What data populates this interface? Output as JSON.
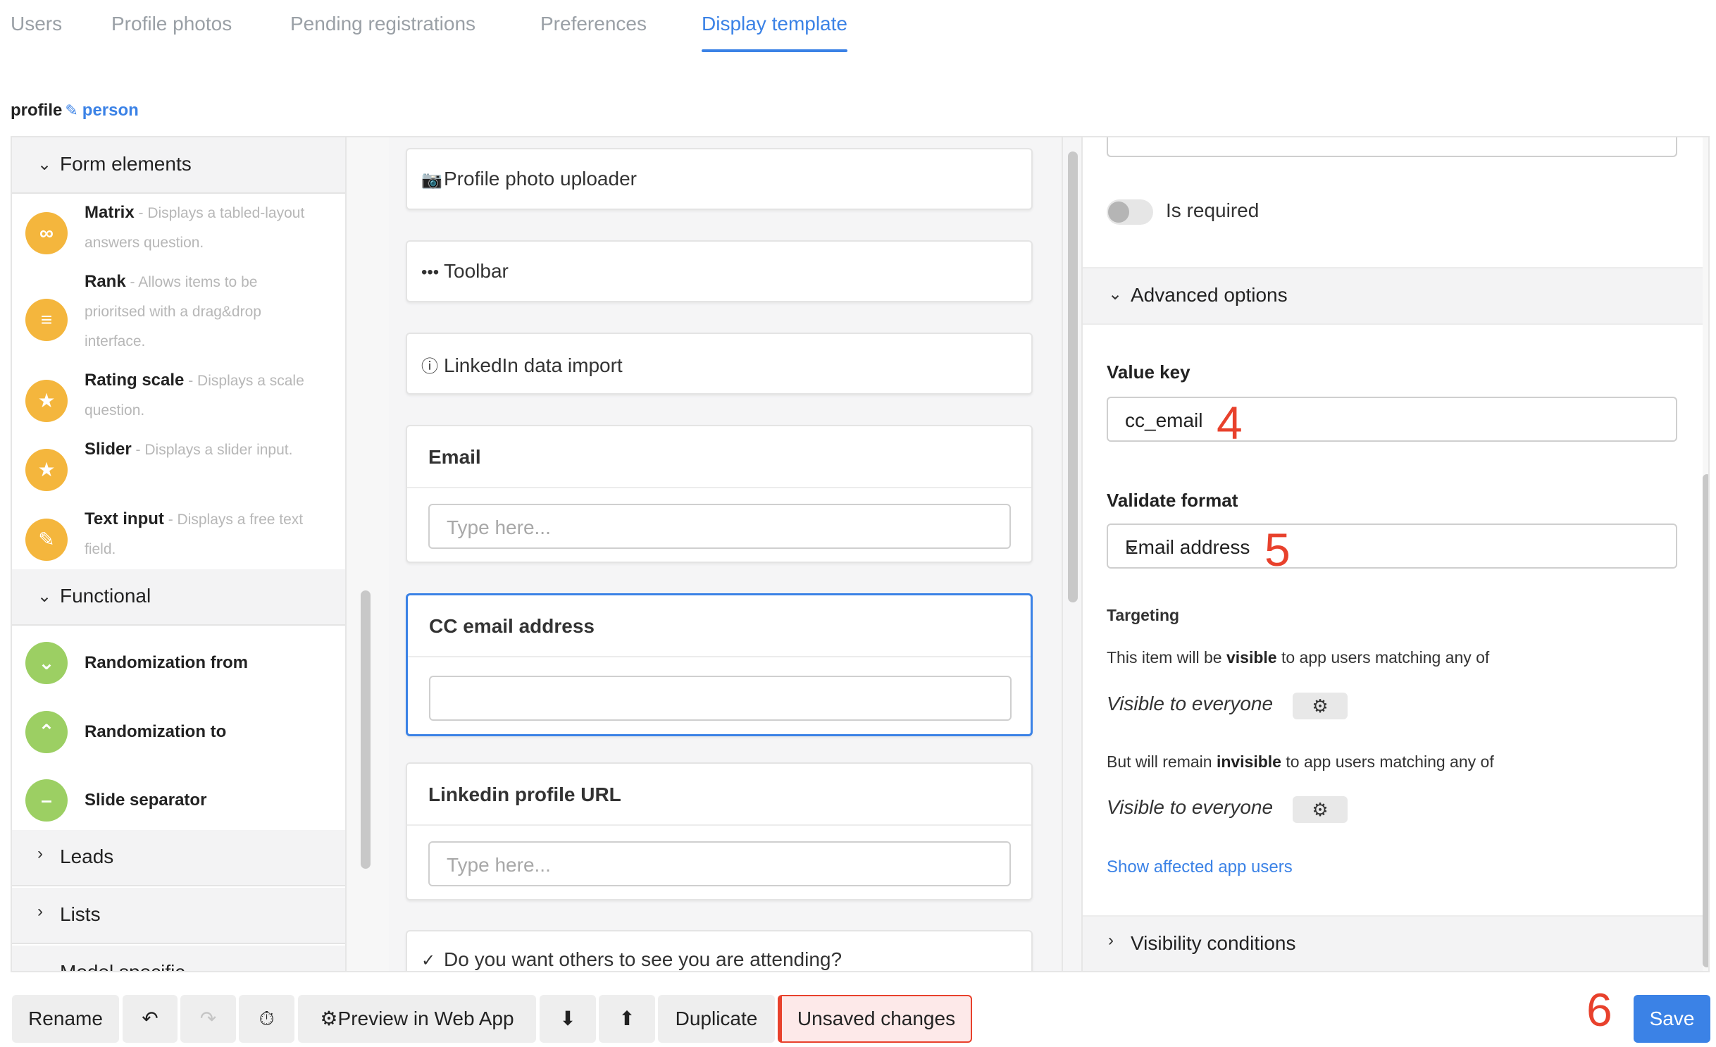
{
  "tabs": [
    "Users",
    "Profile photos",
    "Pending registrations",
    "Preferences",
    "Display template"
  ],
  "breadcrumb": {
    "root": "profile",
    "edit_icon": "pencil-icon",
    "link": "person"
  },
  "palette": {
    "sections": {
      "form_elements": "Form elements",
      "functional": "Functional",
      "leads": "Leads",
      "lists": "Lists",
      "model_specific": "Model specific"
    },
    "form_items": [
      {
        "name": "Matrix",
        "desc": " - Displays a tabled-layout answers question.",
        "icon": "infinity-icon"
      },
      {
        "name": "Rank",
        "desc": " - Allows items to be prioritsed with a drag&drop interface.",
        "icon": "lines-icon"
      },
      {
        "name": "Rating scale",
        "desc": " - Displays a scale question.",
        "icon": "star-icon"
      },
      {
        "name": "Slider",
        "desc": " - Displays a slider input.",
        "icon": "star-icon"
      },
      {
        "name": "Text input",
        "desc": " - Displays a free text field.",
        "icon": "edit-icon"
      }
    ],
    "functional_items": [
      "Randomization from",
      "Randomization to",
      "Slide separator"
    ]
  },
  "canvas": {
    "simple_items": [
      "Profile photo uploader",
      "Toolbar",
      "LinkedIn data import"
    ],
    "email": {
      "title": "Email",
      "placeholder": "Type here..."
    },
    "cc_email": {
      "title": "CC email address",
      "value": ""
    },
    "linkedin_url": {
      "title": "Linkedin profile URL",
      "placeholder": "Type here..."
    },
    "attending": "Do you want others to see you are attending?"
  },
  "props": {
    "is_required_label": "Is required",
    "is_required": false,
    "advanced_options": "Advanced options",
    "value_key_label": "Value key",
    "value_key": "cc_email",
    "validate_format_label": "Validate format",
    "validate_format": "Email address",
    "targeting_title": "Targeting",
    "visible_text_pre": "This item will be ",
    "visible_word": "visible",
    "visible_text_post": " to app users matching any of",
    "visible_to": "Visible to everyone",
    "invisible_text_pre": "But will remain ",
    "invisible_word": "invisible",
    "invisible_text_post": " to app users matching any of",
    "invisible_to": "Visible to everyone",
    "show_affected": "Show affected app users",
    "visibility_conditions": "Visibility conditions"
  },
  "annotations": [
    "4",
    "5",
    "6"
  ],
  "toolbar": {
    "rename": "Rename",
    "preview": "Preview in Web App",
    "duplicate": "Duplicate",
    "unsaved": "Unsaved changes",
    "save": "Save"
  },
  "colors": {
    "accent": "#3b82e6",
    "orange": "#f4b63d",
    "green": "#9ccf63",
    "alert": "#e8412c"
  }
}
